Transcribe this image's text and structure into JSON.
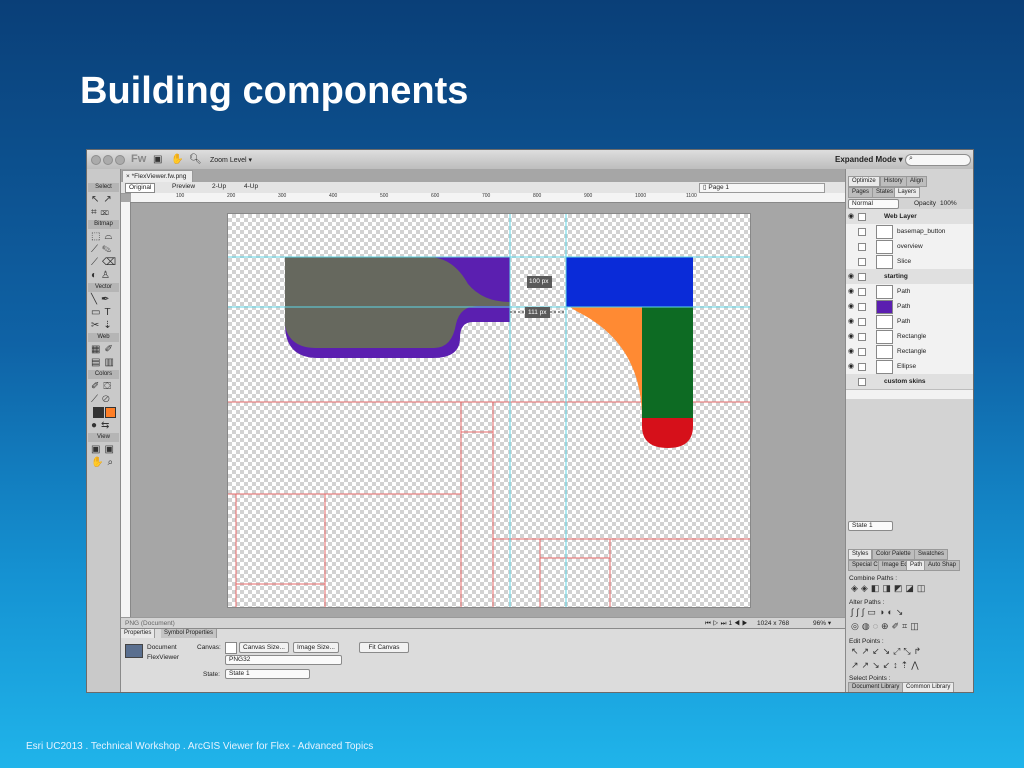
{
  "slide": {
    "title": "Building components",
    "footer": "Esri UC2013 . Technical Workshop . ArcGIS Viewer for Flex - Advanced Topics"
  },
  "app": {
    "logo": "Fw",
    "zoom_label": "Zoom Level",
    "workspace_mode": "Expanded Mode",
    "search_placeholder": ""
  },
  "tools": {
    "sections": [
      "Select",
      "Bitmap",
      "Vector",
      "Web",
      "Colors",
      "View"
    ],
    "stroke_color": "#333333",
    "fill_color": "#ff7f27"
  },
  "document": {
    "tab_name": "*FlexViewer.fw.png",
    "view_modes": [
      "Original",
      "Preview",
      "2-Up",
      "4-Up"
    ],
    "page_selector": "Page 1",
    "ruler_ticks": [
      "100",
      "200",
      "300",
      "400",
      "500",
      "600",
      "700",
      "800",
      "900",
      "1000",
      "1100"
    ],
    "guide_label_1": "100 px",
    "guide_label_2": "111 px",
    "status_doc": "PNG (Document)",
    "status_size": "1024 x 768",
    "status_zoom": "96%"
  },
  "properties": {
    "tabs": [
      "Properties",
      "Symbol Properties"
    ],
    "doc_type": "Document",
    "doc_name": "FlexViewer",
    "canvas_label": "Canvas:",
    "canvas_size_button": "Canvas Size...",
    "image_size_button": "Image Size...",
    "fit_canvas_button": "Fit Canvas",
    "format_value": "PNG32",
    "state_label": "State:",
    "state_value": "State 1"
  },
  "right_panel": {
    "tabs_top": [
      "Optimize",
      "History",
      "Align"
    ],
    "tabs_layers": [
      "Pages",
      "States",
      "Layers"
    ],
    "blend_mode": "Normal",
    "opacity_label": "Opacity",
    "opacity_value": "100%",
    "layers": [
      {
        "name": "Web Layer",
        "folder": true
      },
      {
        "name": "basemap_button",
        "folder": false
      },
      {
        "name": "overview",
        "folder": false
      },
      {
        "name": "Slice",
        "folder": false
      },
      {
        "name": "starting",
        "folder": true
      },
      {
        "name": "Path",
        "folder": false
      },
      {
        "name": "Path",
        "folder": false
      },
      {
        "name": "Path",
        "folder": false
      },
      {
        "name": "Rectangle",
        "folder": false
      },
      {
        "name": "Rectangle",
        "folder": false
      },
      {
        "name": "Ellipse",
        "folder": false
      },
      {
        "name": "custom skins",
        "folder": true
      }
    ],
    "state_footer": "State 1",
    "tabs_styles": [
      "Styles",
      "Color Palette",
      "Swatches"
    ],
    "tabs_path": [
      "Special C",
      "Image Ed",
      "Path",
      "Auto Shap"
    ],
    "combine_paths": "Combine Paths :",
    "alter_paths": "Alter Paths :",
    "edit_points": "Edit Points :",
    "select_points": "Select Points :",
    "tabs_bottom": [
      "Document Library",
      "Common Library"
    ]
  },
  "colors": {
    "purple": "#5b1fb0",
    "gray_shape": "#66685e",
    "blue": "#0a2bd8",
    "orange": "#ff8a33",
    "green": "#0d6b23",
    "red": "#d6101a",
    "guide_cyan": "#5fd6e6",
    "slice_red": "#e86a6a"
  }
}
